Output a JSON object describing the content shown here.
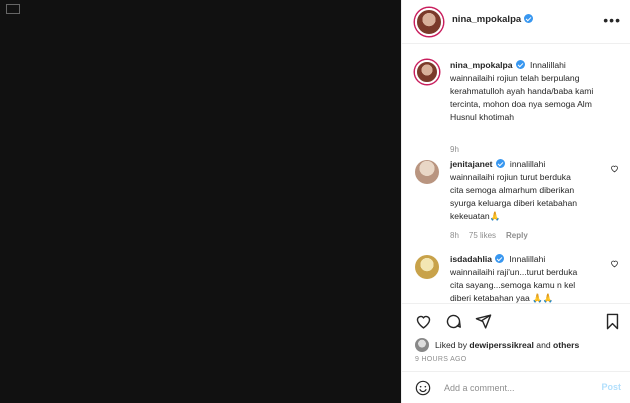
{
  "post": {
    "username": "nina_mpokalpa"
  },
  "comments": [
    {
      "username": "nina_mpokalpa",
      "lines": [
        "Innalillahi",
        "wainnailaihi rojiun telah berpulang",
        "kerahmatulloh ayah handa/baba kami",
        "tercinta, mohon doa nya semoga Alm",
        "Husnul khotimah"
      ],
      "time": "9h"
    },
    {
      "username": "jenitajanet",
      "lines": [
        "innalillahi",
        "wainnailaihi rojiun turut berduka",
        "cita semoga almarhum diberikan",
        "syurga keluarga diberi ketabahan",
        "kekeuatan🙏"
      ],
      "time": "8h",
      "likes": "75 likes",
      "reply": "Reply"
    },
    {
      "username": "isdadahlia",
      "lines": [
        "Innalillahi",
        "wainnailaihi raji'un...turut berduka",
        "cita sayang...semoga kamu n kel",
        "diberi ketabahan yaa 🙏🙏"
      ]
    }
  ],
  "actions": {
    "liked_prefix": "Liked by",
    "liked_user": "dewiperssikreal",
    "liked_and": "and",
    "liked_others": "others",
    "timestamp": "9 HOURS AGO"
  },
  "add_comment": {
    "placeholder": "Add a comment...",
    "post_label": "Post"
  },
  "colors": {
    "verified": "#3897f0",
    "post_button_disabled": "#b2dffc",
    "media_bg": "#111111"
  }
}
